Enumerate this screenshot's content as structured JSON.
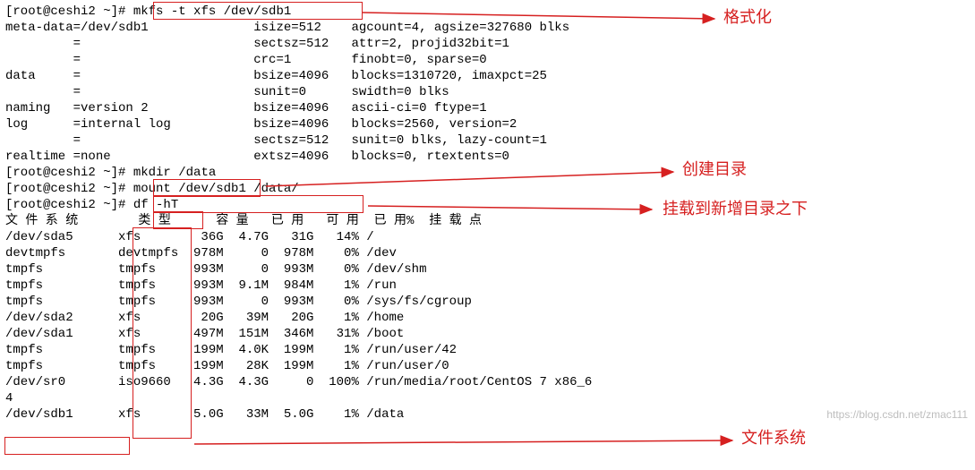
{
  "prompt1": "[root@ceshi2 ~]# ",
  "cmd_mkfs": "mkfs -t xfs /dev/sdb1",
  "mkfs_out": [
    "meta-data=/dev/sdb1              isize=512    agcount=4, agsize=327680 blks",
    "         =                       sectsz=512   attr=2, projid32bit=1",
    "         =                       crc=1        finobt=0, sparse=0",
    "data     =                       bsize=4096   blocks=1310720, imaxpct=25",
    "         =                       sunit=0      swidth=0 blks",
    "naming   =version 2              bsize=4096   ascii-ci=0 ftype=1",
    "log      =internal log           bsize=4096   blocks=2560, version=2",
    "         =                       sectsz=512   sunit=0 blks, lazy-count=1",
    "realtime =none                   extsz=4096   blocks=0, rtextents=0"
  ],
  "cmd_mkdir": "mkdir /data",
  "cmd_mount": "mount /dev/sdb1 /data/",
  "cmd_df": "df -hT",
  "df_header": "文 件 系 统        类 型      容 量   已 用   可 用  已 用%  挂 载 点",
  "df_rows": [
    "/dev/sda5      xfs        36G  4.7G   31G   14% /",
    "devtmpfs       devtmpfs  978M     0  978M    0% /dev",
    "tmpfs          tmpfs     993M     0  993M    0% /dev/shm",
    "tmpfs          tmpfs     993M  9.1M  984M    1% /run",
    "tmpfs          tmpfs     993M     0  993M    0% /sys/fs/cgroup",
    "/dev/sda2      xfs        20G   39M   20G    1% /home",
    "/dev/sda1      xfs       497M  151M  346M   31% /boot",
    "tmpfs          tmpfs     199M  4.0K  199M    1% /run/user/42",
    "tmpfs          tmpfs     199M   28K  199M    1% /run/user/0",
    "/dev/sr0       iso9660   4.3G  4.3G     0  100% /run/media/root/CentOS 7 x86_6",
    "4",
    "/dev/sdb1      xfs       5.0G   33M  5.0G    1% /data"
  ],
  "overflow_line": "                  5.0G   33M  5.0G    1% /data",
  "ann": {
    "format": "格式化",
    "mkdir": "创建目录",
    "mount": "挂载到新增目录之下",
    "fs": "文件系统"
  },
  "watermark": "https://blog.csdn.net/zmac111"
}
